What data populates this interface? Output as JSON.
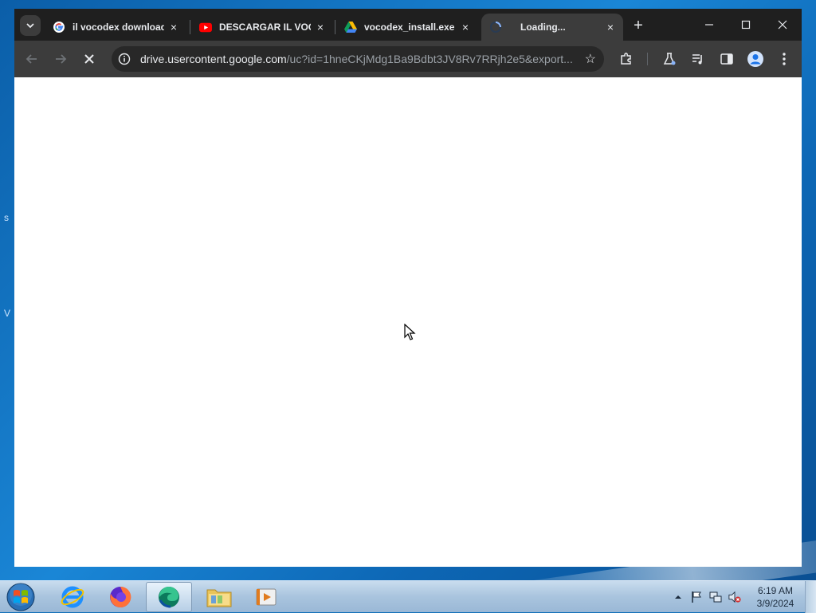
{
  "tabs": [
    {
      "title": "il vocodex download",
      "icon": "google-g-icon",
      "close": "×"
    },
    {
      "title": "DESCARGAR IL VOC",
      "icon": "youtube-icon",
      "close": "×"
    },
    {
      "title": "vocodex_install.exe",
      "icon": "google-drive-icon",
      "close": "×"
    },
    {
      "title": "Loading...",
      "icon": "loading-spinner-icon",
      "close": "×",
      "active": true
    }
  ],
  "new_tab": "+",
  "address_bar": {
    "host": "drive.usercontent.google.com",
    "path": "/uc?id=1hneCKjMdg1Ba9Bdbt3JV8Rv7RRjh2e5&export..."
  },
  "clock": {
    "time": "6:19 AM",
    "date": "3/9/2024"
  },
  "colors": {
    "tabstrip": "#1f1f1f",
    "toolbar": "#3c3c3c",
    "omnibox": "#282828",
    "content": "#ffffff"
  }
}
